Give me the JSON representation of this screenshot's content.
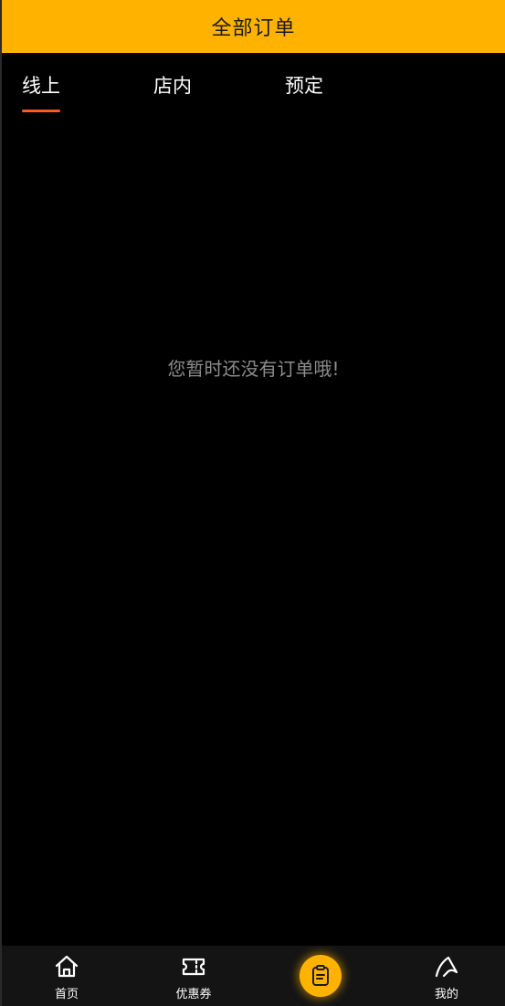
{
  "header": {
    "title": "全部订单"
  },
  "tabs": [
    {
      "label": "线上",
      "active": true
    },
    {
      "label": "店内",
      "active": false
    },
    {
      "label": "预定",
      "active": false
    }
  ],
  "empty_state": {
    "message": "您暂时还没有订单哦!"
  },
  "bottom_nav": {
    "items": [
      {
        "label": "首页",
        "icon": "home-icon"
      },
      {
        "label": "优惠券",
        "icon": "ticket-icon"
      },
      {
        "label": "",
        "icon": "order-clipboard-icon"
      },
      {
        "label": "我的",
        "icon": "user-icon"
      }
    ]
  },
  "colors": {
    "brand": "#ffb300",
    "tab_indicator": "#ff5a1f",
    "background": "#000000",
    "tabbar_bg": "#141414",
    "muted_text": "#8c8c8c"
  }
}
